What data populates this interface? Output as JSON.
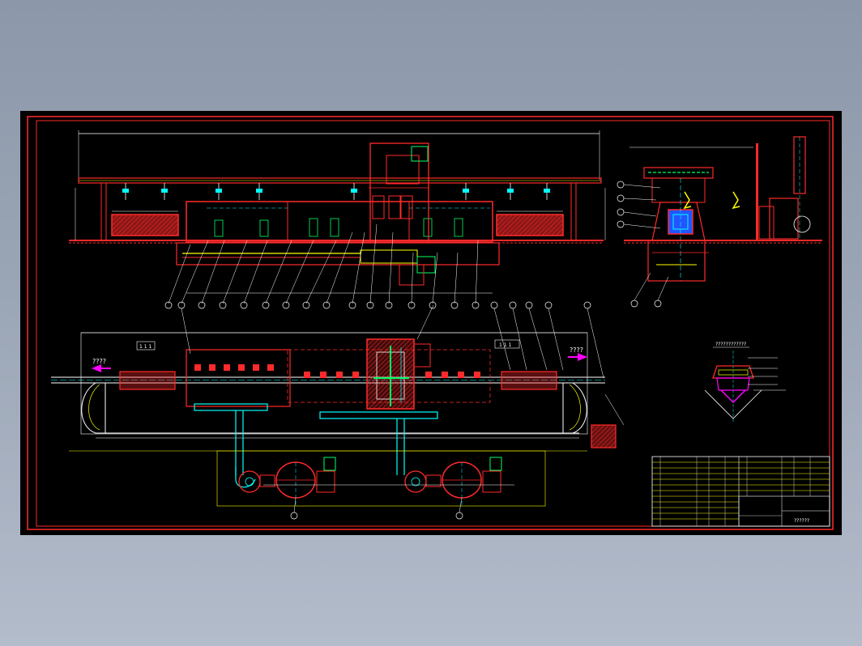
{
  "colors": {
    "background": "#8f9bae",
    "sheet": "#000000",
    "frame": "#ff2a2a",
    "outline": "#ffffff",
    "dimension": "#ffff00",
    "centerline": "#00ffff",
    "component": "#00ff66",
    "hatch": "#ff2a2a",
    "arrow": "#ff00ff",
    "callout": "#ffff66"
  },
  "main": {
    "arrow_left_label": "????",
    "arrow_right_label": "????",
    "box_left_label": "1 1 1",
    "box_right_label": "1 1 1"
  },
  "detail": {
    "heading": "????????????"
  },
  "title_block": {
    "drawing_label": "??????"
  }
}
